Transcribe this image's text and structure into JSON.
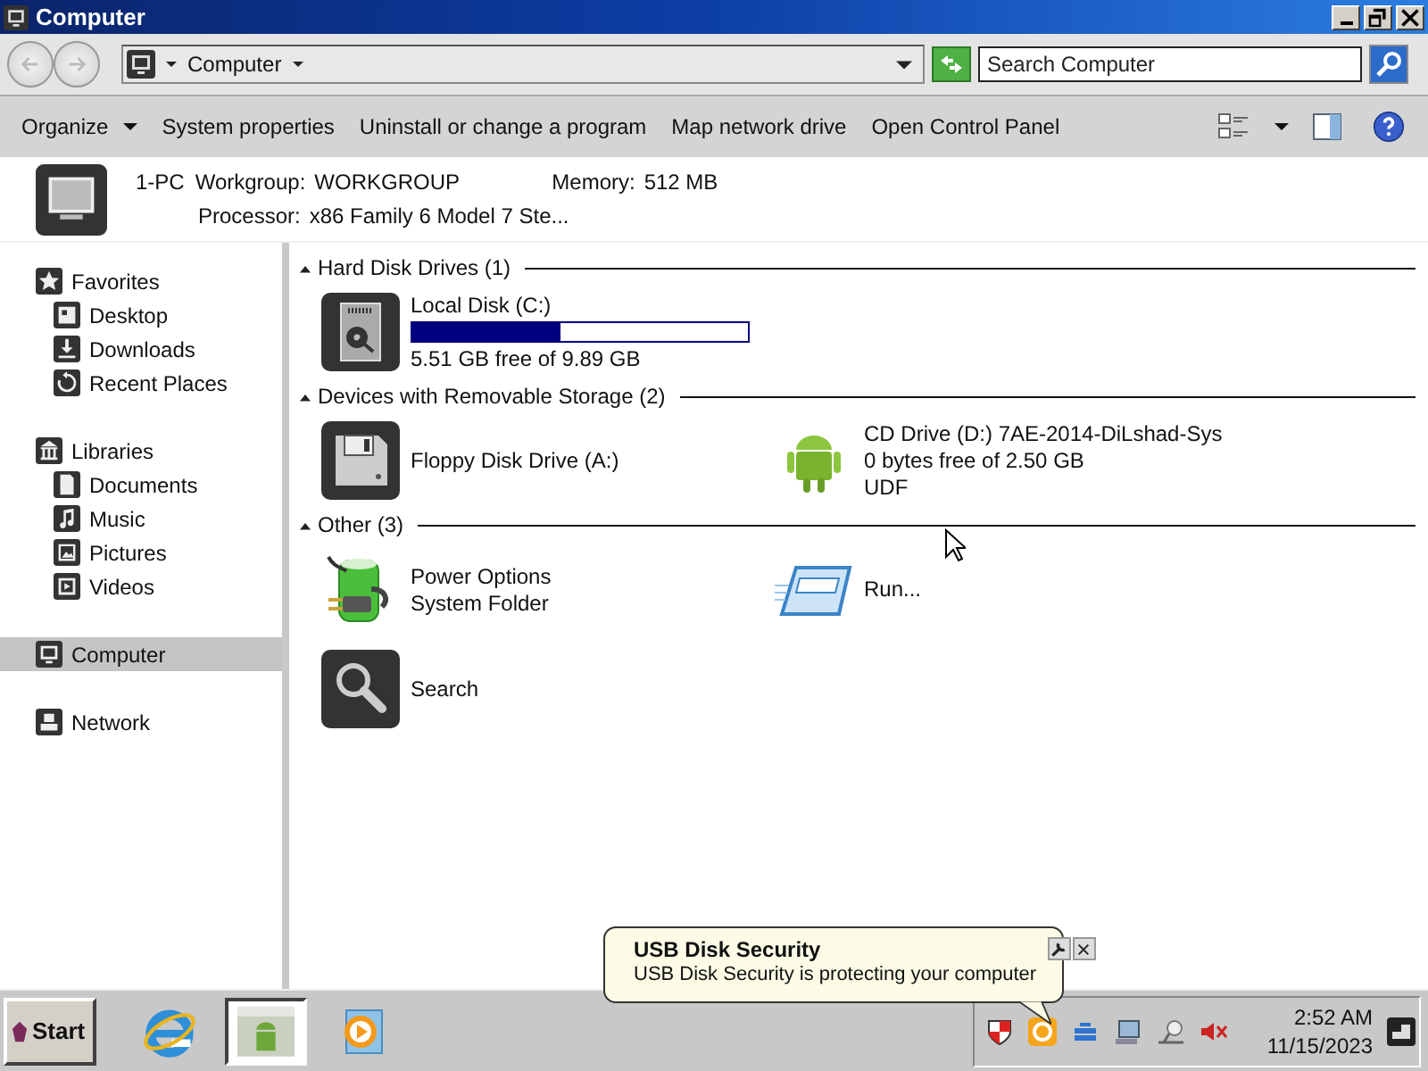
{
  "window": {
    "title": "Computer"
  },
  "address": {
    "crumb": "Computer"
  },
  "search": {
    "placeholder": "Search Computer"
  },
  "toolbar": [
    {
      "label": "Organize",
      "menu": true
    },
    {
      "label": "System properties",
      "menu": false
    },
    {
      "label": "Uninstall or change a program",
      "menu": false
    },
    {
      "label": "Map network drive",
      "menu": false
    },
    {
      "label": "Open Control Panel",
      "menu": false
    }
  ],
  "details": {
    "name": "1-PC",
    "fields": [
      {
        "label": "Workgroup:",
        "value": "WORKGROUP"
      },
      {
        "label": "Memory:",
        "value": "512 MB"
      },
      {
        "label": "Processor:",
        "value": "x86 Family 6 Model 7 Ste..."
      }
    ]
  },
  "sidebar": [
    {
      "label": "Favorites",
      "selected": false,
      "children": [
        {
          "label": "Desktop",
          "selected": false
        },
        {
          "label": "Downloads",
          "selected": false
        },
        {
          "label": "Recent Places",
          "selected": false
        }
      ]
    },
    {
      "label": "Libraries",
      "selected": false,
      "children": [
        {
          "label": "Documents",
          "selected": false
        },
        {
          "label": "Music",
          "selected": false
        },
        {
          "label": "Pictures",
          "selected": false
        },
        {
          "label": "Videos",
          "selected": false
        }
      ]
    },
    {
      "label": "Computer",
      "selected": true
    },
    {
      "label": "Network",
      "selected": false
    }
  ],
  "groups": [
    {
      "title": "Hard Disk Drives (1)",
      "expanded": true,
      "items": [
        {
          "kind": "drive",
          "name": "Local Disk (C:)",
          "level": 0.44,
          "lines": [
            "5.51 GB free of 9.89 GB"
          ]
        }
      ]
    },
    {
      "title": "Devices with Removable Storage (2)",
      "expanded": true,
      "items": [
        {
          "kind": "device",
          "name": "Floppy Disk Drive (A:)"
        },
        {
          "kind": "device",
          "name": "CD Drive (D:) 7AE-2014-DiLshad-Sys",
          "lines": [
            "0 bytes free of 2.50 GB",
            "UDF"
          ]
        }
      ]
    },
    {
      "title": "Other (3)",
      "expanded": true,
      "items": [
        {
          "kind": "device",
          "name": "Power Options",
          "lines": [
            "System Folder"
          ]
        },
        {
          "kind": "device",
          "name": "Run..."
        },
        {
          "kind": "device",
          "name": "Search"
        }
      ]
    }
  ],
  "taskbar": {
    "start": "Start",
    "buttons": [
      {
        "selected": false
      },
      {
        "selected": true
      },
      {
        "selected": false
      }
    ]
  },
  "clock": {
    "time": "2:52 AM",
    "date": "11/15/2023"
  },
  "balloon": {
    "title": "USB Disk Security",
    "message": "USB Disk Security is protecting your computer"
  }
}
